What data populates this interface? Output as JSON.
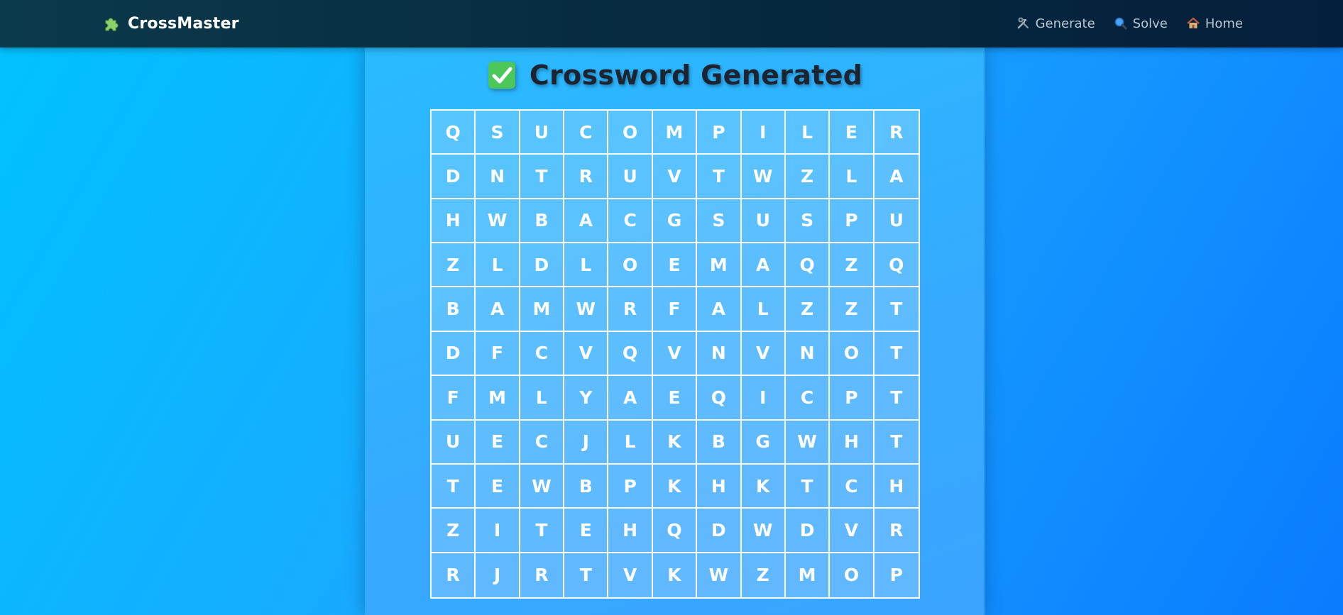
{
  "navbar": {
    "brand": "CrossMaster",
    "brand_icon": "puzzle-piece-icon",
    "links": [
      {
        "label": "Generate",
        "icon": "hammer-wrench-icon"
      },
      {
        "label": "Solve",
        "icon": "magnifier-icon"
      },
      {
        "label": "Home",
        "icon": "house-icon"
      }
    ]
  },
  "main": {
    "title": "Crossword Generated",
    "title_icon": "checkmark-box-icon",
    "grid": [
      [
        "Q",
        "S",
        "U",
        "C",
        "O",
        "M",
        "P",
        "I",
        "L",
        "E",
        "R"
      ],
      [
        "D",
        "N",
        "T",
        "R",
        "U",
        "V",
        "T",
        "W",
        "Z",
        "L",
        "A"
      ],
      [
        "H",
        "W",
        "B",
        "A",
        "C",
        "G",
        "S",
        "U",
        "S",
        "P",
        "U"
      ],
      [
        "Z",
        "L",
        "D",
        "L",
        "O",
        "E",
        "M",
        "A",
        "Q",
        "Z",
        "Q"
      ],
      [
        "B",
        "A",
        "M",
        "W",
        "R",
        "F",
        "A",
        "L",
        "Z",
        "Z",
        "T"
      ],
      [
        "D",
        "F",
        "C",
        "V",
        "Q",
        "V",
        "N",
        "V",
        "N",
        "O",
        "T"
      ],
      [
        "F",
        "M",
        "L",
        "Y",
        "A",
        "E",
        "Q",
        "I",
        "C",
        "P",
        "T"
      ],
      [
        "U",
        "E",
        "C",
        "J",
        "L",
        "K",
        "B",
        "G",
        "W",
        "H",
        "T"
      ],
      [
        "T",
        "E",
        "W",
        "B",
        "P",
        "K",
        "H",
        "K",
        "T",
        "C",
        "H"
      ],
      [
        "Z",
        "I",
        "T",
        "E",
        "H",
        "Q",
        "D",
        "W",
        "D",
        "V",
        "R"
      ],
      [
        "R",
        "J",
        "R",
        "T",
        "V",
        "K",
        "W",
        "Z",
        "M",
        "O",
        "P"
      ]
    ]
  },
  "colors": {
    "accent_green": "#4cc75a",
    "navbar": "#062a3e",
    "background": "#1aa8ff"
  }
}
